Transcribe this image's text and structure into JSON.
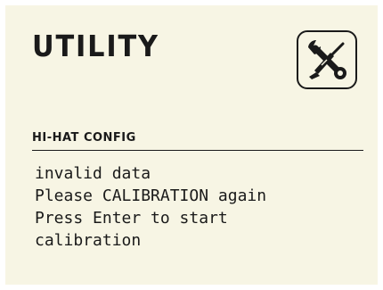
{
  "header": {
    "title": "UTILITY",
    "icon": "wrench-screwdriver-icon"
  },
  "section": {
    "title": "HI-HAT CONFIG"
  },
  "message": {
    "lines": [
      "invalid data",
      "Please CALIBRATION again",
      "Press Enter to start",
      "calibration"
    ]
  }
}
